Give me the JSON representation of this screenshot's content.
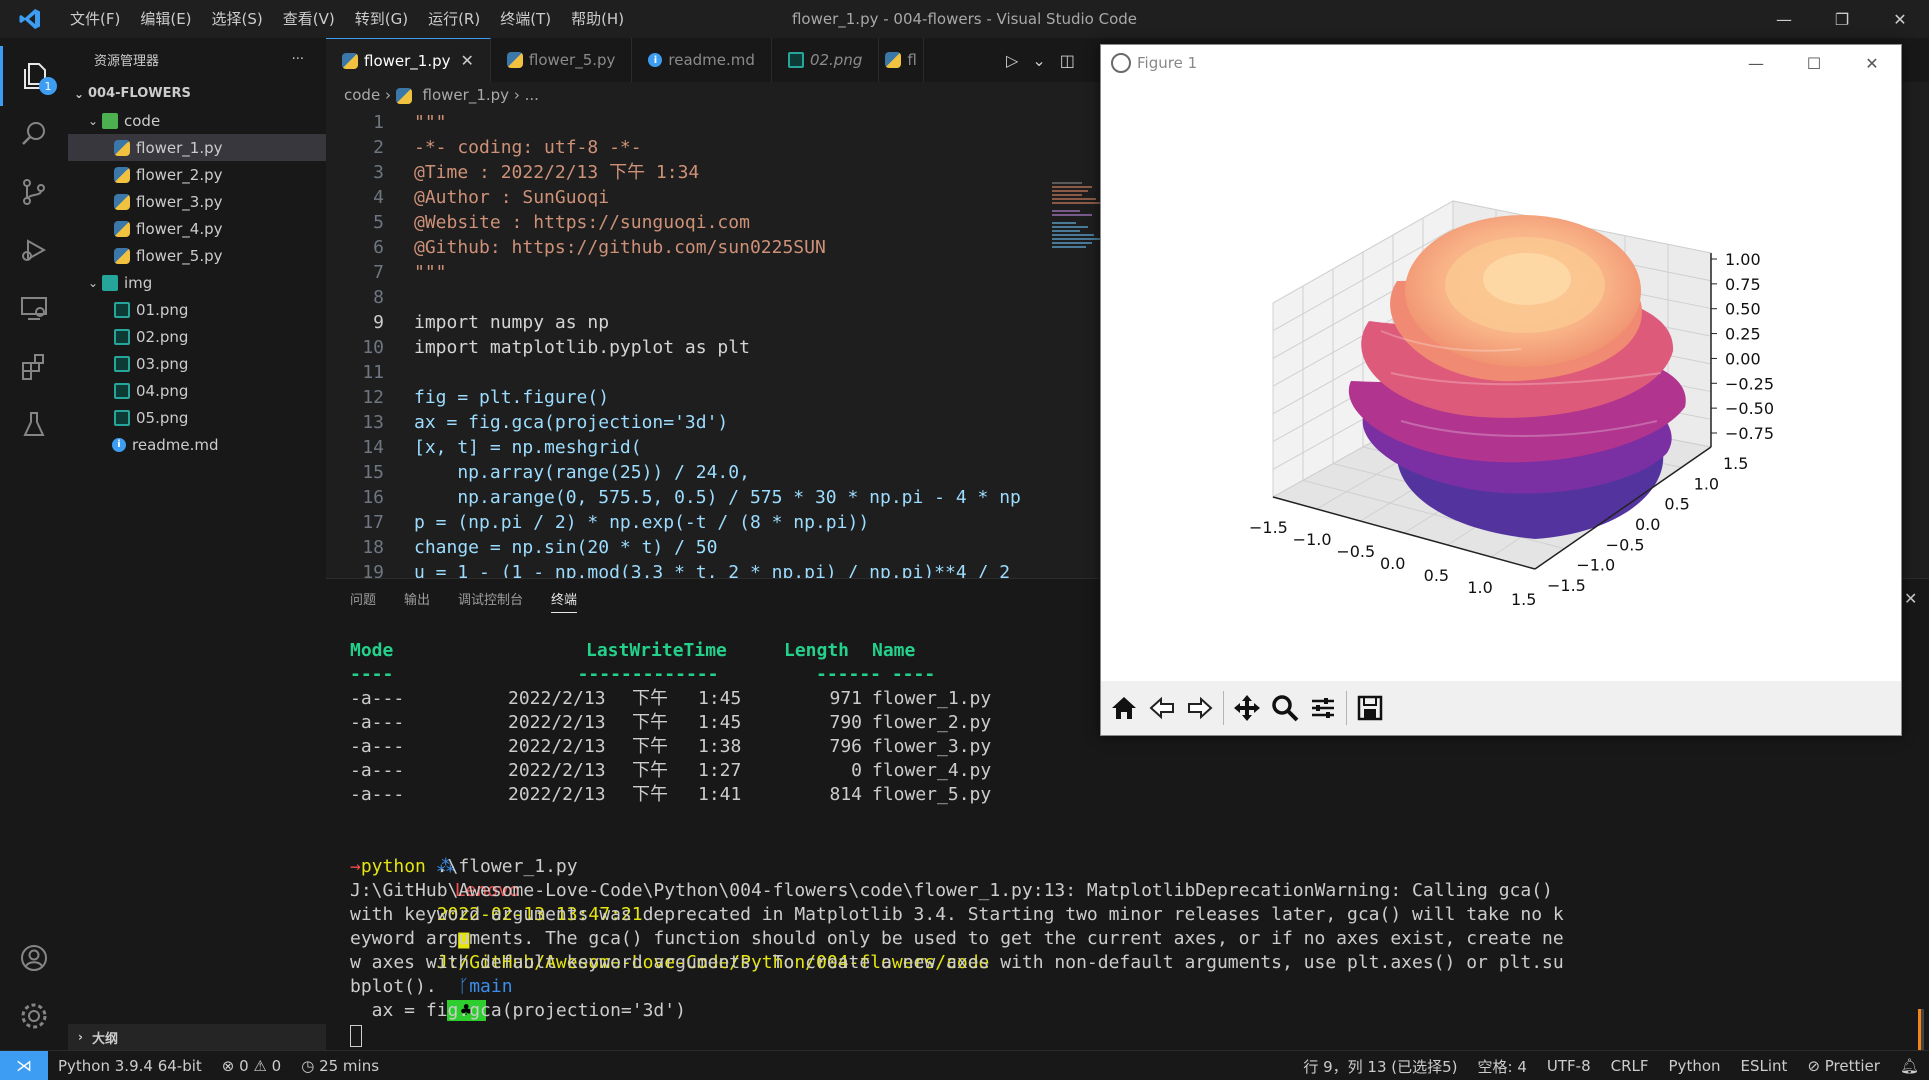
{
  "window": {
    "title": "flower_1.py - 004-flowers - Visual Studio Code",
    "menus": [
      "文件(F)",
      "编辑(E)",
      "选择(S)",
      "查看(V)",
      "转到(G)",
      "运行(R)",
      "终端(T)",
      "帮助(H)"
    ],
    "controls": [
      "—",
      "❐",
      "✕"
    ]
  },
  "activity": {
    "badge": "1"
  },
  "explorer": {
    "title": "资源管理器",
    "more": "···",
    "root": "004-FLOWERS",
    "folder_code": "code",
    "code_files": [
      "flower_1.py",
      "flower_2.py",
      "flower_3.py",
      "flower_4.py",
      "flower_5.py"
    ],
    "folder_img": "img",
    "img_files": [
      "01.png",
      "02.png",
      "03.png",
      "04.png",
      "05.png"
    ],
    "readme": "readme.md",
    "outline": "大纲"
  },
  "tabs": [
    {
      "label": "flower_1.py",
      "close": "✕"
    },
    {
      "label": "flower_5.py"
    },
    {
      "label": "readme.md"
    },
    {
      "label": "02.png"
    },
    {
      "label": "fl"
    }
  ],
  "breadcrumb": [
    "code",
    "flower_1.py",
    "..."
  ],
  "code_lines": [
    {
      "n": "1",
      "t": "\"\"\""
    },
    {
      "n": "2",
      "t": "-*- coding: utf-8 -*-"
    },
    {
      "n": "3",
      "t": "@Time : 2022/2/13 下午 1:34"
    },
    {
      "n": "4",
      "t": "@Author : SunGuoqi"
    },
    {
      "n": "5",
      "t": "@Website : https://sunguoqi.com"
    },
    {
      "n": "6",
      "t": "@Github: https://github.com/sun0225SUN"
    },
    {
      "n": "7",
      "t": "\"\"\""
    },
    {
      "n": "8",
      "t": ""
    },
    {
      "n": "9",
      "t": "import numpy as np"
    },
    {
      "n": "10",
      "t": "import matplotlib.pyplot as plt"
    },
    {
      "n": "11",
      "t": ""
    },
    {
      "n": "12",
      "t": "fig = plt.figure()"
    },
    {
      "n": "13",
      "t": "ax = fig.gca(projection='3d')"
    },
    {
      "n": "14",
      "t": "[x, t] = np.meshgrid("
    },
    {
      "n": "15",
      "t": "    np.array(range(25)) / 24.0,"
    },
    {
      "n": "16",
      "t": "    np.arange(0, 575.5, 0.5) / 575 * 30 * np.pi - 4 * np"
    },
    {
      "n": "17",
      "t": "p = (np.pi / 2) * np.exp(-t / (8 * np.pi))"
    },
    {
      "n": "18",
      "t": "change = np.sin(20 * t) / 50"
    },
    {
      "n": "19",
      "t": "u = 1 - (1 - np.mod(3.3 * t, 2 * np.pi) / np.pi)**4 / 2"
    }
  ],
  "panel": {
    "tabs": [
      "问题",
      "输出",
      "调试控制台",
      "终端"
    ],
    "close": "✕"
  },
  "terminal": {
    "headers": {
      "mode": "Mode",
      "lwt": "LastWriteTime",
      "len": "Length",
      "name": "Name"
    },
    "underline": "----                 -------------         ------ ----",
    "rows": [
      {
        "mode": "-a---",
        "date": "2022/2/13",
        "ampm": "下午",
        "time": "1:45",
        "len": "971",
        "name": "flower_1.py"
      },
      {
        "mode": "-a---",
        "date": "2022/2/13",
        "ampm": "下午",
        "time": "1:45",
        "len": "790",
        "name": "flower_2.py"
      },
      {
        "mode": "-a---",
        "date": "2022/2/13",
        "ampm": "下午",
        "time": "1:38",
        "len": "796",
        "name": "flower_3.py"
      },
      {
        "mode": "-a---",
        "date": "2022/2/13",
        "ampm": "下午",
        "time": "1:27",
        "len": "0",
        "name": "flower_4.py"
      },
      {
        "mode": "-a---",
        "date": "2022/2/13",
        "ampm": "下午",
        "time": "1:41",
        "len": "814",
        "name": "flower_5.py"
      }
    ],
    "prompt_user": "Lenovo",
    "prompt_time": "2022-02-13 13:47:21",
    "prompt_path": "J:/GitHub/Awesome-Love-Code/Python/004-flowers/code",
    "prompt_branch": "main",
    "prompt_mark": "♣",
    "cmd_arrow": "→",
    "cmd": "python",
    "cmd_arg": " .\\flower_1.py",
    "warning": [
      "J:\\GitHub\\Awesome-Love-Code\\Python\\004-flowers\\code\\flower_1.py:13: MatplotlibDeprecationWarning: Calling gca()",
      "with keyword arguments was deprecated in Matplotlib 3.4. Starting two minor releases later, gca() will take no k",
      "eyword arguments. The gca() function should only be used to get the current axes, or if no axes exist, create ne",
      "w axes with default keyword arguments. To create a new axes with non-default arguments, use plt.axes() or plt.su",
      "bplot().",
      "  ax = fig.gca(projection='3d')"
    ]
  },
  "status": {
    "python": "Python 3.9.4 64-bit",
    "errors": "⊗ 0 ⚠ 0",
    "time": "25 mins",
    "position": "行 9，列 13 (已选择5)",
    "spaces": "空格: 4",
    "encoding": "UTF-8",
    "eol": "CRLF",
    "language": "Python",
    "eslint": "ESLint",
    "prettier": "⊘ Prettier"
  },
  "figure": {
    "title": "Figure 1",
    "controls": [
      "—",
      "☐",
      "✕"
    ],
    "z_ticks": [
      "1.00",
      "0.75",
      "0.50",
      "0.25",
      "0.00",
      "−0.25",
      "−0.50",
      "−0.75"
    ],
    "x_ticks": [
      "−1.5",
      "−1.0",
      "−0.5",
      "0.0",
      "0.5",
      "1.0",
      "1.5"
    ],
    "y_ticks": [
      "1.5",
      "1.0",
      "0.5",
      "0.0",
      "−0.5",
      "−1.0",
      "−1.5"
    ],
    "colors": {
      "top": "#fcd4a0",
      "mid": "#f07f6e",
      "low": "#c33f8e",
      "base": "#5c2a9d"
    }
  }
}
